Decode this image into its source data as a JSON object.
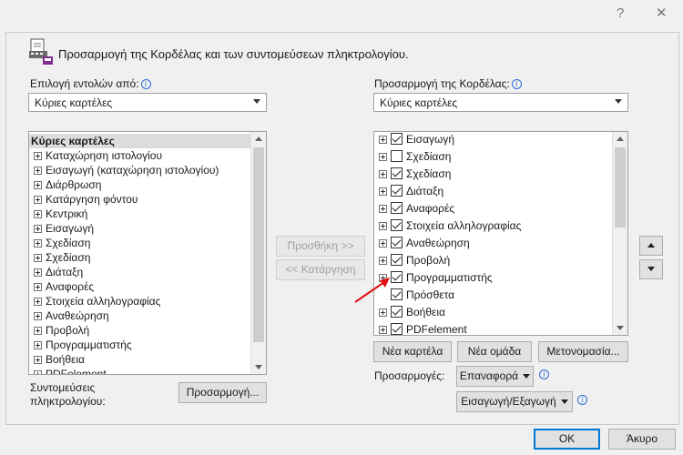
{
  "window": {
    "help": "?",
    "close": "✕"
  },
  "header": {
    "title": "Προσαρμογή της Κορδέλας και των συντομεύσεων πληκτρολογίου."
  },
  "left": {
    "label": "Επιλογή εντολών από:",
    "combo_value": "Κύριες καρτέλες",
    "list_header": "Κύριες καρτέλες",
    "items": [
      "Καταχώρηση ιστολογίου",
      "Εισαγωγή (καταχώρηση ιστολογίου)",
      "Διάρθρωση",
      "Κατάργηση φόντου",
      "Κεντρική",
      "Εισαγωγή",
      "Σχεδίαση",
      "Σχεδίαση",
      "Διάταξη",
      "Αναφορές",
      "Στοιχεία αλληλογραφίας",
      "Αναθεώρηση",
      "Προβολή",
      "Προγραμματιστής",
      "Βοήθεια",
      "PDFelement"
    ]
  },
  "middle": {
    "add": "Προσθήκη >>",
    "remove": "<< Κατάργηση"
  },
  "right": {
    "label": "Προσαρμογή της Κορδέλας:",
    "combo_value": "Κύριες καρτέλες",
    "items": [
      {
        "label": "Εισαγωγή",
        "checked": true,
        "expand": true
      },
      {
        "label": "Σχεδίαση",
        "checked": false,
        "expand": true
      },
      {
        "label": "Σχεδίαση",
        "checked": true,
        "expand": true
      },
      {
        "label": "Διάταξη",
        "checked": true,
        "expand": true
      },
      {
        "label": "Αναφορές",
        "checked": true,
        "expand": true
      },
      {
        "label": "Στοιχεία αλληλογραφίας",
        "checked": true,
        "expand": true
      },
      {
        "label": "Αναθεώρηση",
        "checked": true,
        "expand": true
      },
      {
        "label": "Προβολή",
        "checked": true,
        "expand": true
      },
      {
        "label": "Προγραμματιστής",
        "checked": true,
        "expand": true
      },
      {
        "label": "Πρόσθετα",
        "checked": true,
        "expand": false
      },
      {
        "label": "Βοήθεια",
        "checked": true,
        "expand": true
      },
      {
        "label": "PDFelement",
        "checked": true,
        "expand": true
      }
    ],
    "new_tab": "Νέα καρτέλα",
    "new_group": "Νέα ομάδα",
    "rename": "Μετονομασία...",
    "customizations_label": "Προσαρμογές:",
    "reset": "Επαναφορά",
    "import_export": "Εισαγωγή/Εξαγωγή"
  },
  "shortcuts": {
    "label_line1": "Συντομεύσεις",
    "label_line2": "πληκτρολογίου:",
    "button": "Προσαρμογή..."
  },
  "footer": {
    "ok": "OK",
    "cancel": "Άκυρο"
  }
}
